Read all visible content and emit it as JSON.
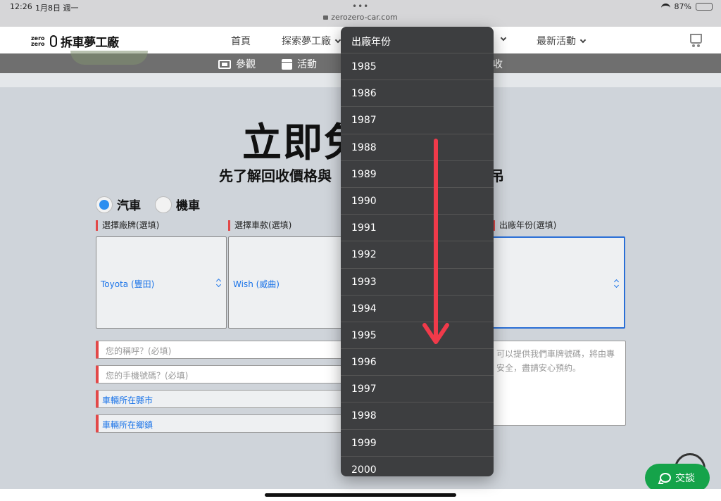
{
  "status_bar": {
    "time": "12:26",
    "date": "1月8日 週一",
    "url": "zerozero-car.com",
    "battery": "87%"
  },
  "site_nav": {
    "logo_small": "zero zero",
    "logo_name": "拆車夢工廠",
    "items": [
      {
        "label": "首頁"
      },
      {
        "label": "探索夢工廠"
      },
      {
        "label": "最新活動"
      }
    ]
  },
  "sub_nav": {
    "items": [
      {
        "label": "參觀",
        "icon": "ticket-icon"
      },
      {
        "label": "活動",
        "icon": "calendar-icon"
      }
    ],
    "tail": "收"
  },
  "hero": {
    "title": "立即免",
    "subtitle": "先了解回收價格與",
    "subtitle_tail": "吊"
  },
  "vehicle_type": {
    "options": [
      {
        "label": "汽車",
        "selected": true
      },
      {
        "label": "機車",
        "selected": false
      }
    ]
  },
  "form": {
    "brand_label": "選擇廠牌(選填)",
    "brand_value": "Toyota (豐田)",
    "model_label": "選擇車款(選填)",
    "model_value": "Wish (威曲)",
    "year_label": "出廠年份(選填)",
    "name_placeholder": "您的稱呼？(必填)",
    "phone_placeholder": "您的手機號碼？(必填)",
    "city_select": "車輛所在縣市",
    "town_select": "車輛所在鄉鎮",
    "note_text": "可以提供我們車牌號碼，將由專\n安全，盡請安心預約。"
  },
  "chat_button": {
    "label": "交談"
  },
  "year_picker": {
    "title": "出廠年份",
    "options": [
      "1985",
      "1986",
      "1987",
      "1988",
      "1989",
      "1990",
      "1991",
      "1992",
      "1993",
      "1994",
      "1995",
      "1996",
      "1997",
      "1998",
      "1999",
      "2000"
    ]
  },
  "colors": {
    "accent_blue": "#1a73e8",
    "required_red": "#e24848",
    "chat_green": "#15a34a",
    "picker_bg": "#3d3e40",
    "drag_arrow": "#f03a4a"
  }
}
